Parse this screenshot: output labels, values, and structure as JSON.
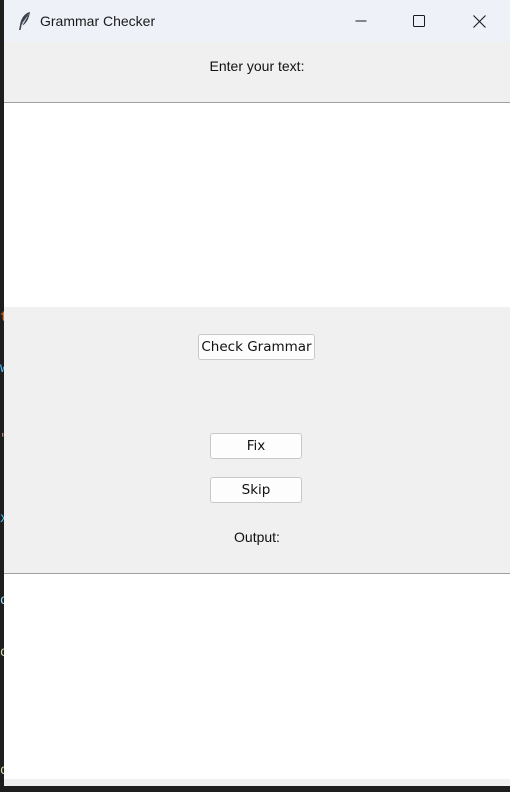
{
  "window": {
    "title": "Grammar Checker",
    "controls": {
      "minimize": "minimize-icon",
      "maximize": "maximize-icon",
      "close": "close-icon"
    },
    "app_icon": "feather-icon"
  },
  "input_section": {
    "label": "Enter your text:",
    "text": ""
  },
  "actions": {
    "check_label": "Check Grammar",
    "fix_label": "Fix",
    "skip_label": "Skip"
  },
  "output_section": {
    "label": "Output:",
    "text": ""
  },
  "colors": {
    "window_bg": "#f0f0f0",
    "titlebar_bg": "#eef1f7",
    "textbox_bg": "#ffffff",
    "button_border": "#c9c9c9"
  }
}
